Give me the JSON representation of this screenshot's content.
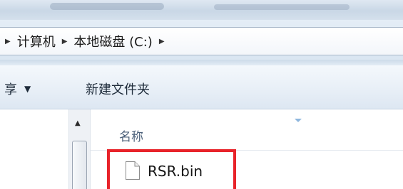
{
  "address_bar": {
    "breadcrumbs": [
      {
        "label": "计算机"
      },
      {
        "label": "本地磁盘 (C:)"
      }
    ]
  },
  "toolbar": {
    "share_label": "享",
    "new_folder_label": "新建文件夹"
  },
  "file_list": {
    "column_header_name": "名称",
    "files": [
      {
        "name": "RSR.bin",
        "icon": "document-icon"
      }
    ]
  },
  "annotation": {
    "highlight_color": "#e8232a"
  },
  "icons": {
    "breadcrumb_separator": "▶",
    "dropdown": "▼",
    "scroll_up": "▲"
  }
}
